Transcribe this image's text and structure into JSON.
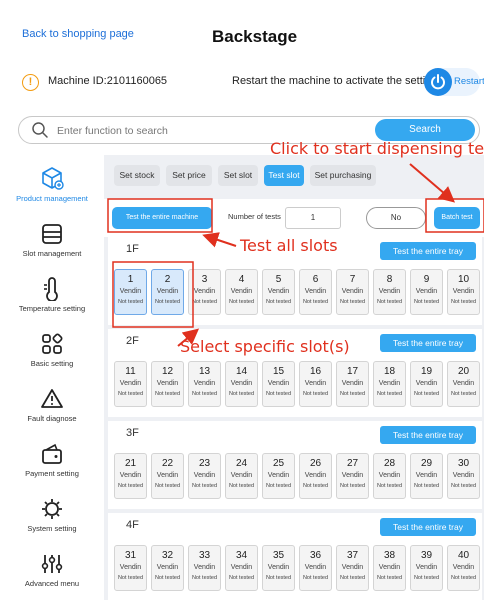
{
  "header": {
    "back_link": "Back to shopping page",
    "title": "Backstage",
    "machine_id": "Machine ID:2101160065",
    "restart_hint": "Restart the machine to activate the settings",
    "restart_label": "Restart"
  },
  "search": {
    "placeholder": "Enter function to search",
    "button_label": "Search"
  },
  "sidebar": {
    "items": [
      {
        "label": "Product management",
        "icon": "product-box-icon",
        "active": true
      },
      {
        "label": "Slot management",
        "icon": "slot-tray-icon"
      },
      {
        "label": "Temperature setting",
        "icon": "thermometer-icon"
      },
      {
        "label": "Basic setting",
        "icon": "grid-settings-icon"
      },
      {
        "label": "Fault diagnose",
        "icon": "warning-icon"
      },
      {
        "label": "Payment setting",
        "icon": "wallet-icon"
      },
      {
        "label": "System setting",
        "icon": "system-gear-icon"
      },
      {
        "label": "Advanced menu",
        "icon": "sliders-icon"
      }
    ]
  },
  "tabs": [
    {
      "label": "Set stock"
    },
    {
      "label": "Set price"
    },
    {
      "label": "Set slot"
    },
    {
      "label": "Test slot",
      "active": true
    },
    {
      "label": "Set purchasing"
    }
  ],
  "controls": {
    "test_machine_label": "Test the entire machine",
    "num_tests_label": "Number of tests",
    "num_tests_value": "1",
    "no_label": "No",
    "batch_label": "Batch test"
  },
  "annotations": {
    "dispense": "Click to start dispensing test",
    "test_all": "Test all slots",
    "select_slots": "Select specific slot(s)"
  },
  "trays": [
    {
      "title": "1F",
      "button_label": "Test the entire tray",
      "slots": [
        {
          "num": "1",
          "name": "Vendin",
          "status": "Not tested",
          "selected": true
        },
        {
          "num": "2",
          "name": "Vendin",
          "status": "Not tested",
          "selected": true
        },
        {
          "num": "3",
          "name": "Vendin",
          "status": "Not tested"
        },
        {
          "num": "4",
          "name": "Vendin",
          "status": "Not tested"
        },
        {
          "num": "5",
          "name": "Vendin",
          "status": "Not tested"
        },
        {
          "num": "6",
          "name": "Vendin",
          "status": "Not tested"
        },
        {
          "num": "7",
          "name": "Vendin",
          "status": "Not tested"
        },
        {
          "num": "8",
          "name": "Vendin",
          "status": "Not tested"
        },
        {
          "num": "9",
          "name": "Vendin",
          "status": "Not tested"
        },
        {
          "num": "10",
          "name": "Vendin",
          "status": "Not tested"
        }
      ]
    },
    {
      "title": "2F",
      "button_label": "Test the entire tray",
      "slots": [
        {
          "num": "11",
          "name": "Vendin",
          "status": "Not tested"
        },
        {
          "num": "12",
          "name": "Vendin",
          "status": "Not tested"
        },
        {
          "num": "13",
          "name": "Vendin",
          "status": "Not tested"
        },
        {
          "num": "14",
          "name": "Vendin",
          "status": "Not tested"
        },
        {
          "num": "15",
          "name": "Vendin",
          "status": "Not tested"
        },
        {
          "num": "16",
          "name": "Vendin",
          "status": "Not tested"
        },
        {
          "num": "17",
          "name": "Vendin",
          "status": "Not tested"
        },
        {
          "num": "18",
          "name": "Vendin",
          "status": "Not tested"
        },
        {
          "num": "19",
          "name": "Vendin",
          "status": "Not tested"
        },
        {
          "num": "20",
          "name": "Vendin",
          "status": "Not tested"
        }
      ]
    },
    {
      "title": "3F",
      "button_label": "Test the entire tray",
      "slots": [
        {
          "num": "21",
          "name": "Vendin",
          "status": "Not tested"
        },
        {
          "num": "22",
          "name": "Vendin",
          "status": "Not tested"
        },
        {
          "num": "23",
          "name": "Vendin",
          "status": "Not tested"
        },
        {
          "num": "24",
          "name": "Vendin",
          "status": "Not tested"
        },
        {
          "num": "25",
          "name": "Vendin",
          "status": "Not tested"
        },
        {
          "num": "26",
          "name": "Vendin",
          "status": "Not tested"
        },
        {
          "num": "27",
          "name": "Vendin",
          "status": "Not tested"
        },
        {
          "num": "28",
          "name": "Vendin",
          "status": "Not tested"
        },
        {
          "num": "29",
          "name": "Vendin",
          "status": "Not tested"
        },
        {
          "num": "30",
          "name": "Vendin",
          "status": "Not tested"
        }
      ]
    },
    {
      "title": "4F",
      "button_label": "Test the entire tray",
      "slots": [
        {
          "num": "31",
          "name": "Vendin",
          "status": "Not tested"
        },
        {
          "num": "32",
          "name": "Vendin",
          "status": "Not tested"
        },
        {
          "num": "33",
          "name": "Vendin",
          "status": "Not tested"
        },
        {
          "num": "34",
          "name": "Vendin",
          "status": "Not tested"
        },
        {
          "num": "35",
          "name": "Vendin",
          "status": "Not tested"
        },
        {
          "num": "36",
          "name": "Vendin",
          "status": "Not tested"
        },
        {
          "num": "37",
          "name": "Vendin",
          "status": "Not tested"
        },
        {
          "num": "38",
          "name": "Vendin",
          "status": "Not tested"
        },
        {
          "num": "39",
          "name": "Vendin",
          "status": "Not tested"
        },
        {
          "num": "40",
          "name": "Vendin",
          "status": "Not tested"
        }
      ]
    }
  ],
  "colors": {
    "accent": "#35a8f0",
    "annotation": "#e0301e",
    "warning": "#f39c12",
    "selected_slot": "#d8e9fb"
  }
}
